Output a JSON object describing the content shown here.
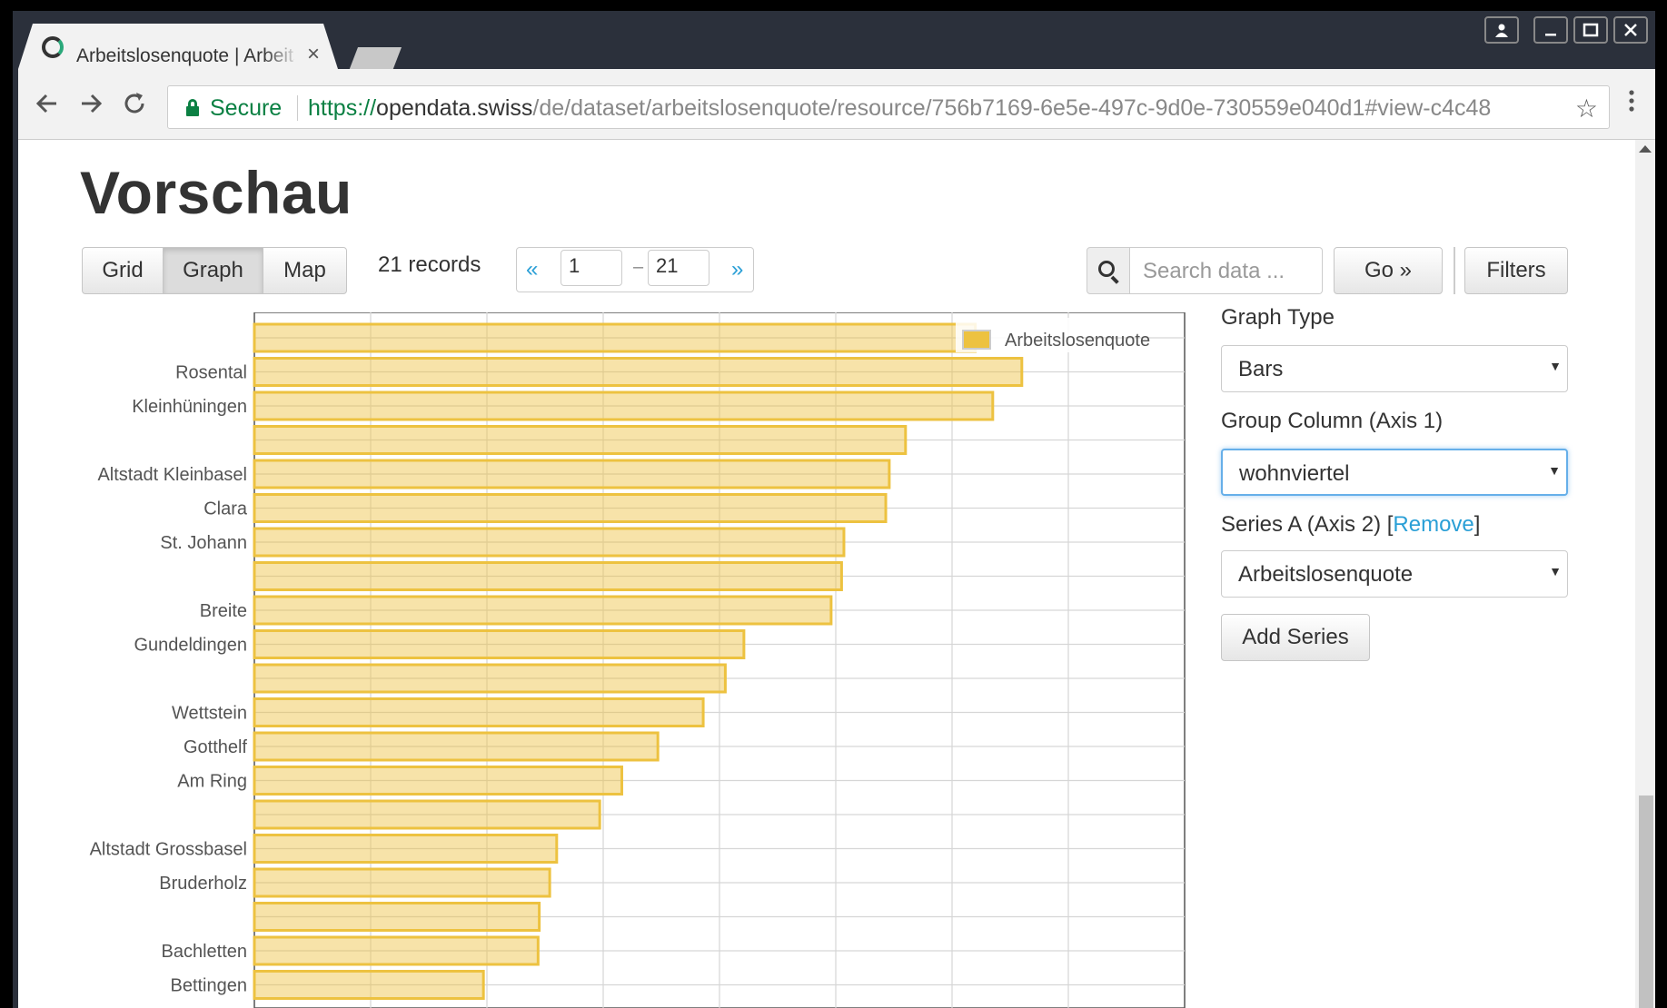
{
  "browser": {
    "tab_title": "Arbeitslosenquote | Arbeitslosenquote",
    "secure_label": "Secure",
    "url_scheme": "https://",
    "url_host": "opendata.swiss",
    "url_path": "/de/dataset/arbeitslosenquote/resource/756b7169-6e5e-497c-9d0e-730559e040d1#view-c4c48"
  },
  "page": {
    "title": "Vorschau",
    "views": [
      "Grid",
      "Graph",
      "Map"
    ],
    "active_view": "Graph",
    "records": "21 records",
    "pager": {
      "prev": "«",
      "from": "1",
      "dash": "–",
      "to": "21",
      "next": "»"
    },
    "search_placeholder": "Search data ...",
    "go_label": "Go »",
    "filters_label": "Filters"
  },
  "form": {
    "graph_type_label": "Graph Type",
    "graph_type_value": "Bars",
    "group_column_label": "Group Column (Axis 1)",
    "group_column_value": "wohnviertel",
    "series_label": "Series A (Axis 2) [",
    "remove_label": "Remove",
    "series_label_end": "]",
    "series_value": "Arbeitslosenquote",
    "add_series_label": "Add Series"
  },
  "chart_data": {
    "type": "bar",
    "orientation": "horizontal",
    "legend": "Arbeitslosenquote",
    "legend_position": "top-right",
    "grid": true,
    "bar_color": "#edc240",
    "categories": [
      "",
      "Rosental",
      "Kleinhüningen",
      "",
      "Altstadt Kleinbasel",
      "Clara",
      "St. Johann",
      "",
      "Breite",
      "Gundeldingen",
      "",
      "Wettstein",
      "Gotthelf",
      "Am Ring",
      "",
      "Altstadt Grossbasel",
      "Bruderholz",
      "",
      "Bachletten",
      "Bettingen"
    ],
    "values": [
      6.2,
      6.6,
      6.35,
      5.6,
      5.46,
      5.43,
      5.07,
      5.05,
      4.96,
      4.21,
      4.05,
      3.86,
      3.47,
      3.16,
      2.97,
      2.6,
      2.54,
      2.45,
      2.44,
      1.97
    ],
    "xlim": [
      0,
      8
    ]
  }
}
